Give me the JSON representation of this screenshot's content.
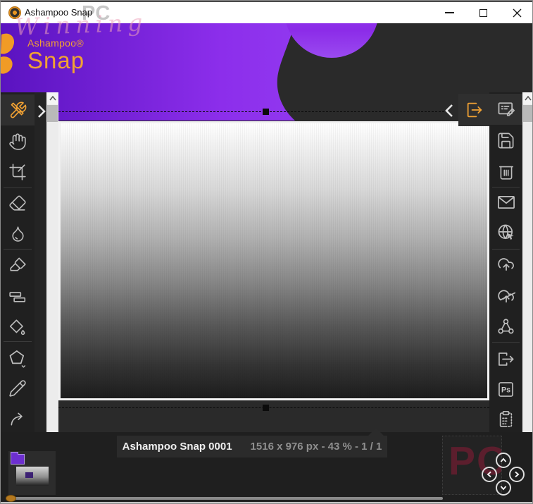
{
  "titlebar": {
    "app_title": "Ashampoo Snap",
    "watermark_script": "Winning",
    "watermark_pc": "PC",
    "controls": [
      "minimize",
      "maximize",
      "close"
    ]
  },
  "header": {
    "brand": "Ashampoo®",
    "product": "Snap"
  },
  "left_toolbar": {
    "active_tool": "tools",
    "items": [
      "tools",
      "pan-hand",
      "crop",
      "eraser",
      "blur-droplet",
      "highlighter",
      "layered-rectangles",
      "fill-color",
      "shape-pentagon",
      "pencil",
      "curved-arrow"
    ],
    "expand_icon": "chevron-right"
  },
  "right_toolbar": {
    "active_item": "export-output",
    "collapse_icon": "chevron-left",
    "items": [
      "edit-note",
      "save",
      "delete",
      "email",
      "web-upload",
      "cloud-upload",
      "cloud-upload-alt",
      "share",
      "export-file",
      "photoshop",
      "clipboard-paste"
    ],
    "photoshop_label": "Ps"
  },
  "statusbar": {
    "document_name": "Ashampoo Snap 0001",
    "details": "1516 x 976 px - 43 % - 1 / 1",
    "image_size": "1516 x 976 px",
    "zoom": "43 %",
    "page": "1 / 1"
  },
  "footer": {
    "watermark_pc": "PC",
    "nav": [
      "up",
      "left",
      "right",
      "down"
    ]
  },
  "colors": {
    "accent_orange": "#f2a233",
    "purple_bright": "#9137ef",
    "purple_deep": "#5a13c0",
    "titlebar_bg": "#ffffff",
    "panel_bg": "#202020",
    "status_dim_text": "#8f8f8f",
    "watermark_red": "#5c1e2d"
  }
}
